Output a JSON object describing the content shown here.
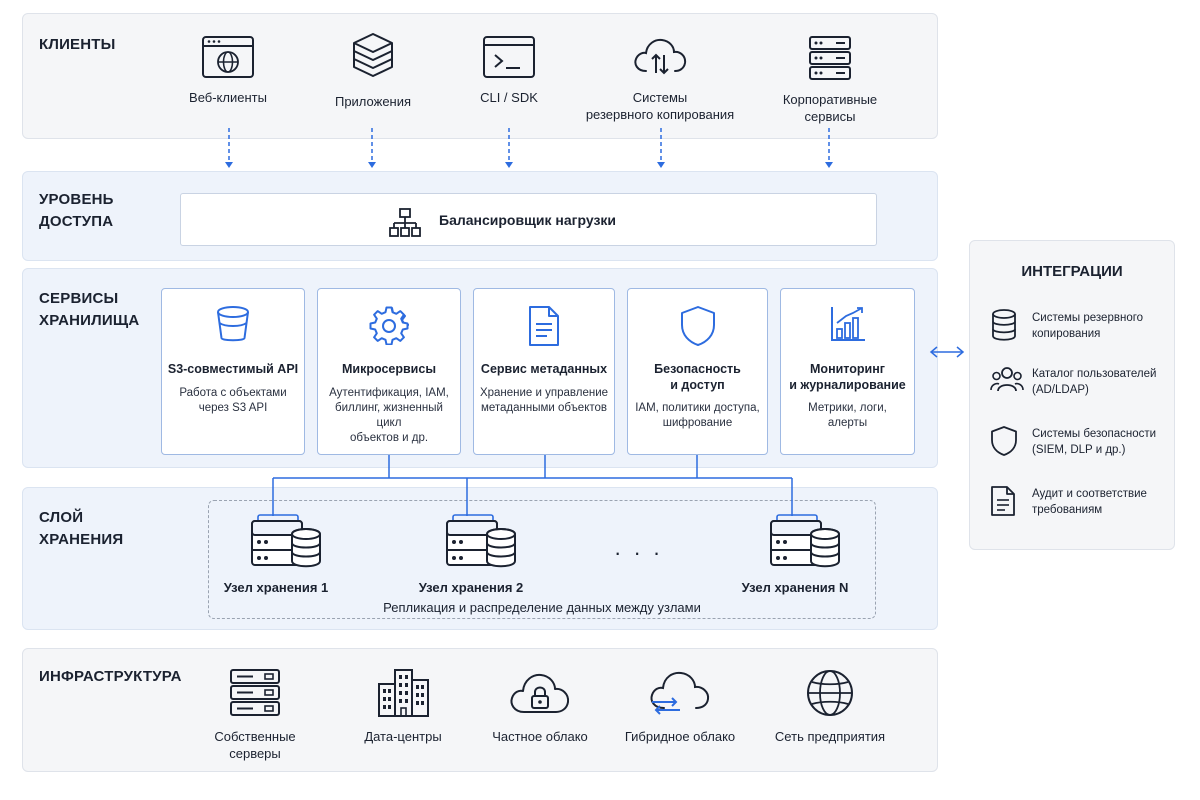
{
  "layers": {
    "clients": {
      "title": "КЛИЕНТЫ",
      "items": [
        {
          "label": "Веб-клиенты",
          "icon": "web-browser-icon"
        },
        {
          "label": "Приложения",
          "icon": "layers-stack-icon"
        },
        {
          "label": "CLI / SDK",
          "icon": "terminal-icon"
        },
        {
          "label": "Системы\nрезервного копирования",
          "icon": "cloud-sync-icon"
        },
        {
          "label": "Корпоративные\nсервисы",
          "icon": "server-rack-icon"
        }
      ]
    },
    "access": {
      "title": "УРОВЕНЬ\nДОСТУПА",
      "load_balancer": "Балансировщик нагрузки"
    },
    "services": {
      "title": "СЕРВИСЫ\nХРАНИЛИЩА",
      "cards": [
        {
          "title": "S3-совместимый API",
          "desc": "Работа с объектами\nчерез S3 API",
          "icon": "bucket-icon"
        },
        {
          "title": "Микросервисы",
          "desc": "Аутентификация, IAM,\nбиллинг, жизненный цикл\nобъектов и др.",
          "icon": "gear-icon"
        },
        {
          "title": "Сервис метаданных",
          "desc": "Хранение и управление\nметаданными объектов",
          "icon": "document-icon"
        },
        {
          "title": "Безопасность\nи доступ",
          "desc": "IAM, политики доступа,\nшифрование",
          "icon": "shield-icon"
        },
        {
          "title": "Мониторинг\nи журналирование",
          "desc": "Метрики, логи,\nалерты",
          "icon": "chart-icon"
        }
      ]
    },
    "storage": {
      "title": "СЛОЙ\nХРАНЕНИЯ",
      "nodes": [
        "Узел хранения 1",
        "Узел хранения 2",
        "Узел хранения N"
      ],
      "ellipsis": "· · ·",
      "replication": "Репликация и распределение данных между узлами"
    },
    "infrastructure": {
      "title": "ИНФРАСТРУКТУРА",
      "items": [
        {
          "label": "Собственные\nсерверы",
          "icon": "server-stack-icon"
        },
        {
          "label": "Дата-центры",
          "icon": "buildings-icon"
        },
        {
          "label": "Частное облако",
          "icon": "cloud-lock-icon"
        },
        {
          "label": "Гибридное облако",
          "icon": "cloud-arrows-icon"
        },
        {
          "label": "Сеть предприятия",
          "icon": "globe-icon"
        }
      ]
    }
  },
  "integrations": {
    "title": "ИНТЕГРАЦИИ",
    "items": [
      {
        "label": "Системы резервного\nкопирования",
        "icon": "database-icon"
      },
      {
        "label": "Каталог пользователей\n(AD/LDAP)",
        "icon": "users-icon"
      },
      {
        "label": "Системы безопасности\n(SIEM, DLP и др.)",
        "icon": "shield-icon"
      },
      {
        "label": "Аудит и соответствие\nтребованиям",
        "icon": "document-icon"
      }
    ]
  },
  "colors": {
    "accent": "#2d6cdf",
    "stroke": "#1b2230",
    "layer_grey": "#f5f6f8",
    "layer_blue": "#eef3fb"
  }
}
